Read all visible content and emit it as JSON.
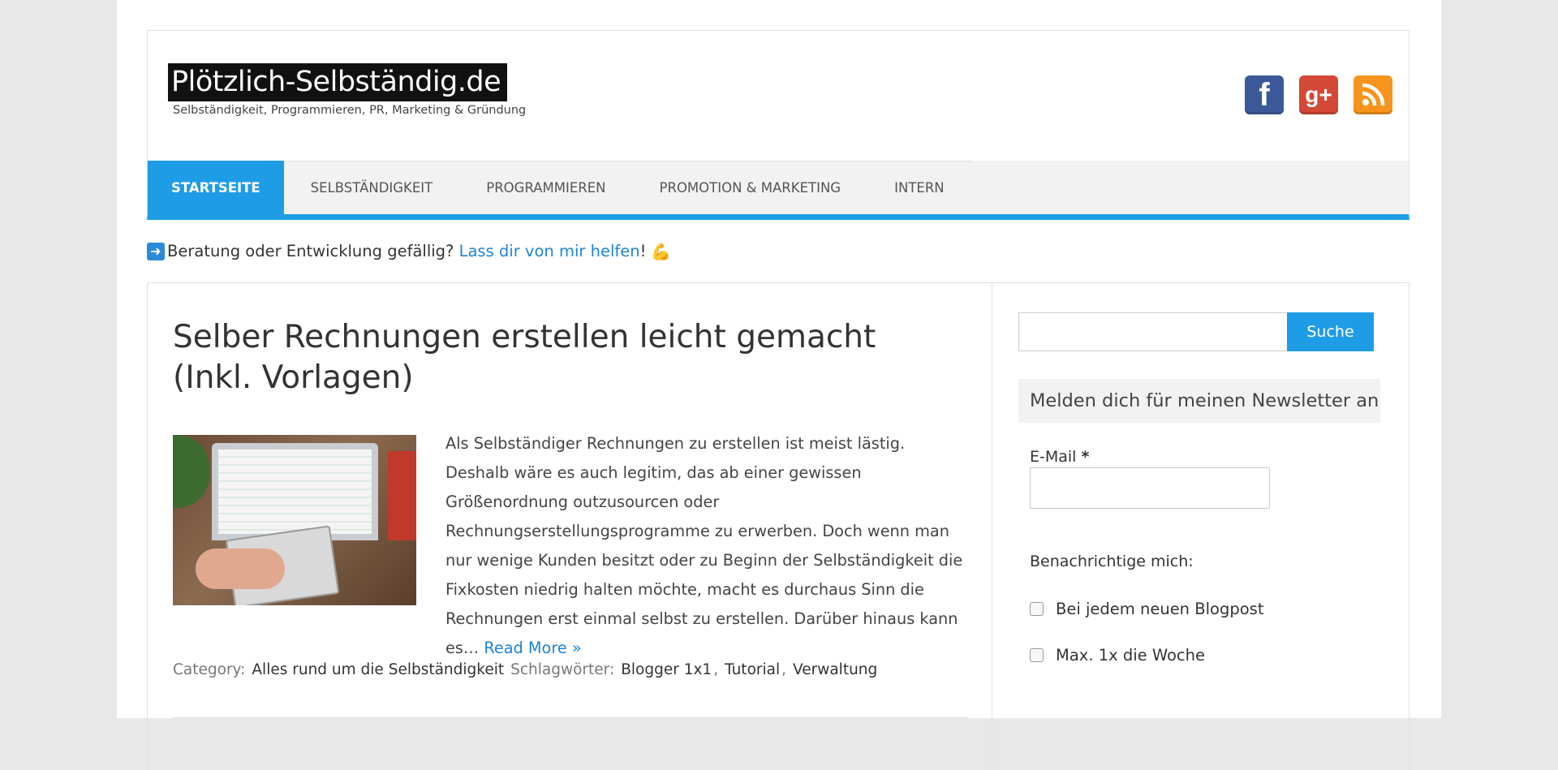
{
  "header": {
    "logo_title": "Plötzlich-Selbständig.de",
    "logo_subtitle": "Selbständigkeit, Programmieren, PR, Marketing & Gründung",
    "social": [
      {
        "name": "facebook-icon",
        "glyph": "f"
      },
      {
        "name": "google-plus-icon",
        "glyph": "g+"
      },
      {
        "name": "rss-icon",
        "glyph": ""
      }
    ]
  },
  "nav": {
    "items": [
      {
        "label": "Startseite",
        "active": true
      },
      {
        "label": "Selbständigkeit",
        "active": false
      },
      {
        "label": "Programmieren",
        "active": false
      },
      {
        "label": "Promotion & Marketing",
        "active": false
      },
      {
        "label": "Intern",
        "active": false
      }
    ]
  },
  "notice": {
    "text": "Beratung oder Entwicklung gefällig?",
    "link": "Lass dir von mir helfen",
    "suffix": "!"
  },
  "post": {
    "title": "Selber Rechnungen erstellen leicht gemacht (Inkl. Vorlagen)",
    "excerpt": "Als Selbständiger Rechnungen zu erstellen ist meist lästig. Deshalb wäre es auch legitim, das ab einer gewissen Größenordnung outzusourcen oder Rechnungserstellungsprogramme zu erwerben. Doch wenn man nur wenige Kunden besitzt oder zu Beginn der Selbständigkeit die Fixkosten niedrig halten möchte, macht es durchaus Sinn die Rechnungen erst einmal selbst zu erstellen. Darüber hinaus kann es…",
    "read_more": "Read More »",
    "category_label": "Category:",
    "category": "Alles rund um die Selbständigkeit",
    "tags_label": "Schlagwörter:",
    "tags": [
      "Blogger 1x1",
      "Tutorial",
      "Verwaltung"
    ]
  },
  "sidebar": {
    "search_button": "Suche",
    "search_value": "",
    "newsletter_title": "Melden dich für meinen Newsletter an",
    "email_label": "E-Mail",
    "email_required": "*",
    "email_value": "",
    "notify_label": "Benachrichtige mich:",
    "options": [
      "Bei jedem neuen Blogpost",
      "Max. 1x die Woche"
    ]
  },
  "colors": {
    "accent": "#1e9ce6",
    "link": "#1e84d6",
    "facebook": "#3b5998",
    "google_plus": "#d34836",
    "rss": "#f7941d"
  }
}
